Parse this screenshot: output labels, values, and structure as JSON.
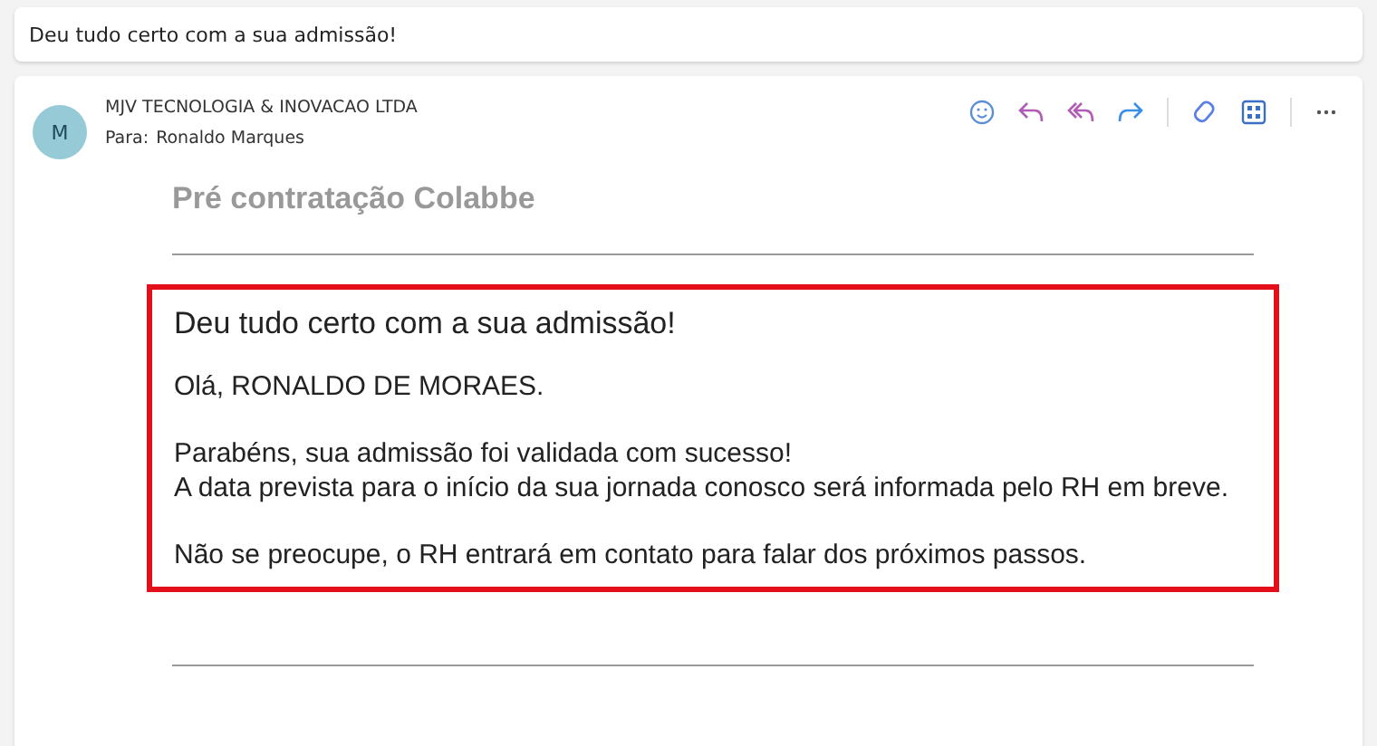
{
  "subject": "Deu tudo certo com a sua admissão!",
  "message": {
    "avatar": "M",
    "sender": "MJV TECNOLOGIA & INOVACAO LTDA",
    "to_label": "Para:",
    "to": "Ronaldo Marques"
  },
  "body": {
    "heading": "Pré contratação Colabbe",
    "box_title": "Deu tudo certo com a sua admissão!",
    "paragraphs": [
      [
        "Olá, RONALDO DE MORAES."
      ],
      [
        "Parabéns, sua admissão foi validada com sucesso!",
        "A data prevista para o início da sua jornada conosco será informada pelo RH em breve."
      ],
      [
        "Não se preocupe, o RH entrará em contato para falar dos próximos passos."
      ]
    ]
  }
}
